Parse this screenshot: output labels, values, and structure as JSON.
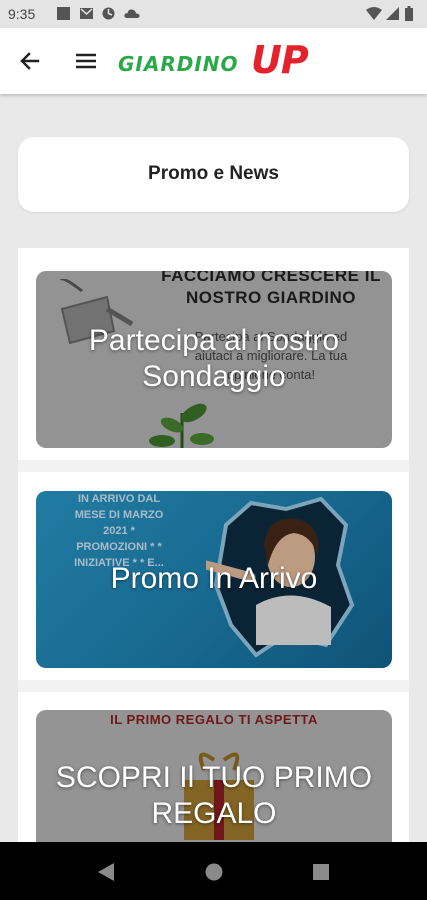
{
  "status": {
    "time": "9:35"
  },
  "appbar": {
    "logo_text": "GIARDINO",
    "logo_up": "UP"
  },
  "section_title": "Promo e News",
  "cards": [
    {
      "title": "Partecipa al nostro Sondaggio",
      "bg_heading": "FACCIAMO CRESCERE IL NOSTRO GIARDINO",
      "bg_text": "Partecipa al Sondaggio ed aiutaci a migliorare. La tua opinione conta!"
    },
    {
      "title": "Promo In Arrivo",
      "bg_text": "IN ARRIVO DAL MESE DI MARZO 2021 * PROMOZIONI * * INIZIATIVE * * E..."
    },
    {
      "title": "SCOPRI Il TUO PRIMO REGALO",
      "bg_heading": "IL PRIMO REGALO TI ASPETTA"
    }
  ],
  "colors": {
    "logo_green": "#2aa84a",
    "logo_red": "#e3222b",
    "promo_blue": "#1f86b8"
  }
}
